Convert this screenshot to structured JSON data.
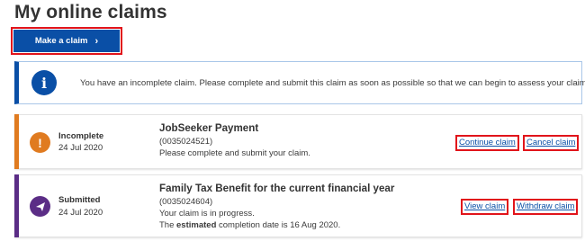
{
  "page": {
    "title": "My online claims"
  },
  "make_claim": {
    "label": "Make a claim",
    "icon": "chevron-right-icon"
  },
  "info_banner": {
    "icon": "info-icon",
    "text": "You have an incomplete claim. Please complete and submit this claim as soon as possible so that we can begin to assess your claim."
  },
  "claims": [
    {
      "status": "Incomplete",
      "date": "24 Jul 2020",
      "status_icon": "exclamation-icon",
      "status_color": "#e07b20",
      "title": "JobSeeker Payment",
      "reference": "(0035024521)",
      "message": "Please complete and submit your claim.",
      "actions": [
        "Continue claim",
        "Cancel claim"
      ]
    },
    {
      "status": "Submitted",
      "date": "24 Jul 2020",
      "status_icon": "paper-plane-icon",
      "status_color": "#5b2d86",
      "title": "Family Tax Benefit for the current financial year",
      "reference": "(0035024604)",
      "message": "Your claim is in progress.",
      "completion_prefix": "The ",
      "completion_bold": "estimated",
      "completion_suffix": " completion date is 16 Aug 2020.",
      "actions": [
        "View claim",
        "Withdraw claim"
      ]
    }
  ],
  "colors": {
    "primary": "#0a4fa6",
    "highlight": "#e1141b"
  }
}
